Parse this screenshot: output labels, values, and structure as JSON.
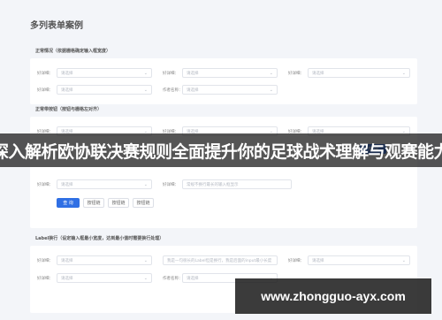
{
  "page": {
    "title": "多列表单案例"
  },
  "sections": [
    {
      "title": "正常情况（依据栅格确定输入框宽度）"
    },
    {
      "title": "正常带按钮（按钮与栅格左对齐）"
    },
    {
      "title": "Label换行（设定输入框最小宽度，达到最小值时需要换行处理）"
    }
  ],
  "fields": {
    "label_short": "好详细：",
    "label_author": "作者名称：",
    "placeholder": "请选择",
    "long_placeholder_1": "常规不换行最长的输入框显示",
    "long_placeholder_2": "我是一句很长的Label但是换行，我是后面的input最小长度"
  },
  "buttons": {
    "query": "查 询",
    "reset_1": "按钮链",
    "reset_2": "按钮链",
    "reset_3": "按钮链",
    "right_primary": "查 询"
  },
  "overlay": {
    "headline": "深入解析欧协联决赛规则全面提升你的足球战术理解与观赛能力",
    "url": "www.zhongguo-ayx.com"
  },
  "colors": {
    "primary": "#2f6fe4",
    "background": "#f3f5f9"
  }
}
